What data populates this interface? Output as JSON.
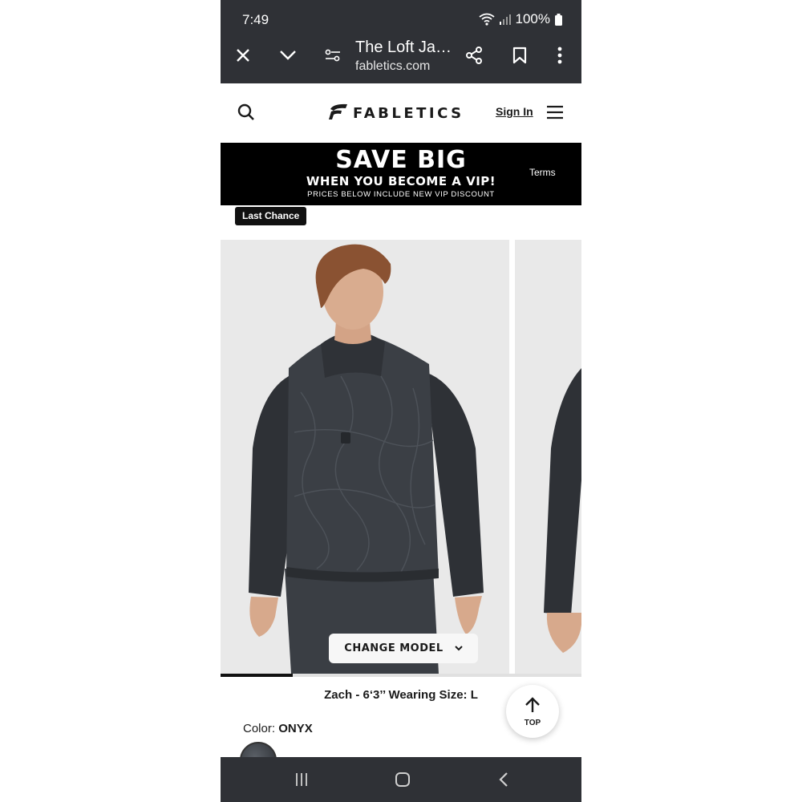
{
  "status_bar": {
    "time": "7:49",
    "battery": "100%"
  },
  "browser": {
    "title": "The Loft Ja…",
    "url": "fabletics.com"
  },
  "site_header": {
    "brand": "FABLETICS",
    "sign_in": "Sign In"
  },
  "banner": {
    "title": "SAVE BIG",
    "subtitle": "WHEN YOU BECOME A VIP!",
    "note": "PRICES BELOW INCLUDE NEW VIP DISCOUNT",
    "terms": "Terms"
  },
  "badge": "Last Chance",
  "gallery": {
    "change_model": "CHANGE MODEL",
    "progress": 0.2
  },
  "model_info": "Zach - 6‘3’’ Wearing Size: L",
  "top_button": "TOP",
  "color": {
    "label": "Color: ",
    "value": "ONYX"
  },
  "colors": {
    "chrome": "#2f3136",
    "banner": "#000000",
    "badge": "#111111",
    "photo_bg": "#e9e9e9"
  }
}
